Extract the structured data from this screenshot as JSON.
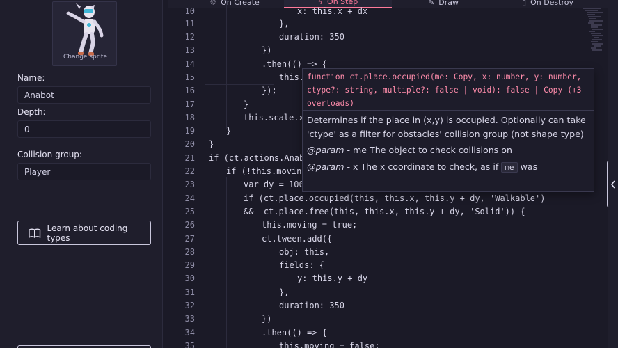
{
  "sprite": {
    "label": "Change sprite"
  },
  "fields": {
    "name_label": "Name:",
    "name_value": "Anabot",
    "depth_label": "Depth:",
    "depth_value": "0",
    "collision_label": "Collision group:",
    "collision_value": "Player"
  },
  "learn_button": {
    "label": "Learn about coding types",
    "icon": "book-icon"
  },
  "tabs": [
    {
      "label": "On Create",
      "icon": "sun-icon"
    },
    {
      "label": "On Step",
      "icon": "bolt-icon",
      "active": true
    },
    {
      "label": "Draw",
      "icon": "pencil-icon"
    },
    {
      "label": "On Destroy",
      "icon": "trash-icon"
    }
  ],
  "code": {
    "lines": [
      {
        "n": "10",
        "text": "x: this.x + dx"
      },
      {
        "n": "11",
        "text": "},"
      },
      {
        "n": "12",
        "text": "duration: 350"
      },
      {
        "n": "13",
        "text": "})"
      },
      {
        "n": "14",
        "text": ".then(() => {"
      },
      {
        "n": "15",
        "text": "this."
      },
      {
        "n": "16",
        "text": "});"
      },
      {
        "n": "17",
        "text": "}"
      },
      {
        "n": "18",
        "text": "this.scale.x"
      },
      {
        "n": "19",
        "text": "}"
      },
      {
        "n": "20",
        "text": "}"
      },
      {
        "n": "21",
        "text": "if (ct.actions.Anabot"
      },
      {
        "n": "22",
        "text": "if (!this.moving)"
      },
      {
        "n": "23",
        "text": "var dy = 100*"
      },
      {
        "n": "24",
        "text": "if (ct.place.occupied(this, this.x, this.y + dy, 'Walkable')"
      },
      {
        "n": "25",
        "text": "&&  ct.place.free(this, this.x, this.y + dy, 'Solid')) {"
      },
      {
        "n": "26",
        "text": "this.moving = true;"
      },
      {
        "n": "27",
        "text": "ct.tween.add({"
      },
      {
        "n": "28",
        "text": "obj: this,"
      },
      {
        "n": "29",
        "text": "fields: {"
      },
      {
        "n": "30",
        "text": "y: this.y + dy"
      },
      {
        "n": "31",
        "text": "},"
      },
      {
        "n": "32",
        "text": "duration: 350"
      },
      {
        "n": "33",
        "text": "})"
      },
      {
        "n": "34",
        "text": ".then(() => {"
      },
      {
        "n": "35",
        "text": "this.moving = false;"
      }
    ]
  },
  "tooltip": {
    "signature": "function ct.place.occupied(me: Copy, x: number, y: number, ctype?: string, multiple?: false | void): false | Copy (+3 overloads)",
    "description": "Determines if the place in (x,y) is occupied. Optionally can take 'ctype' as a filter for obstacles' collision group (not shape type)",
    "param_me_tag": "@param",
    "param_me_text": "- me The object to check collisions on",
    "param_x_tag": "@param",
    "param_x_text": "- x The x coordinate to check, as if",
    "param_x_code": "me",
    "param_x_tail": "was"
  },
  "colors": {
    "background": "#1b1a27",
    "panel": "#1f1e2c",
    "accent": "#ff7a9a",
    "keyword": "#d6ea72",
    "string": "#9fe86f",
    "number": "#ff8cab"
  }
}
